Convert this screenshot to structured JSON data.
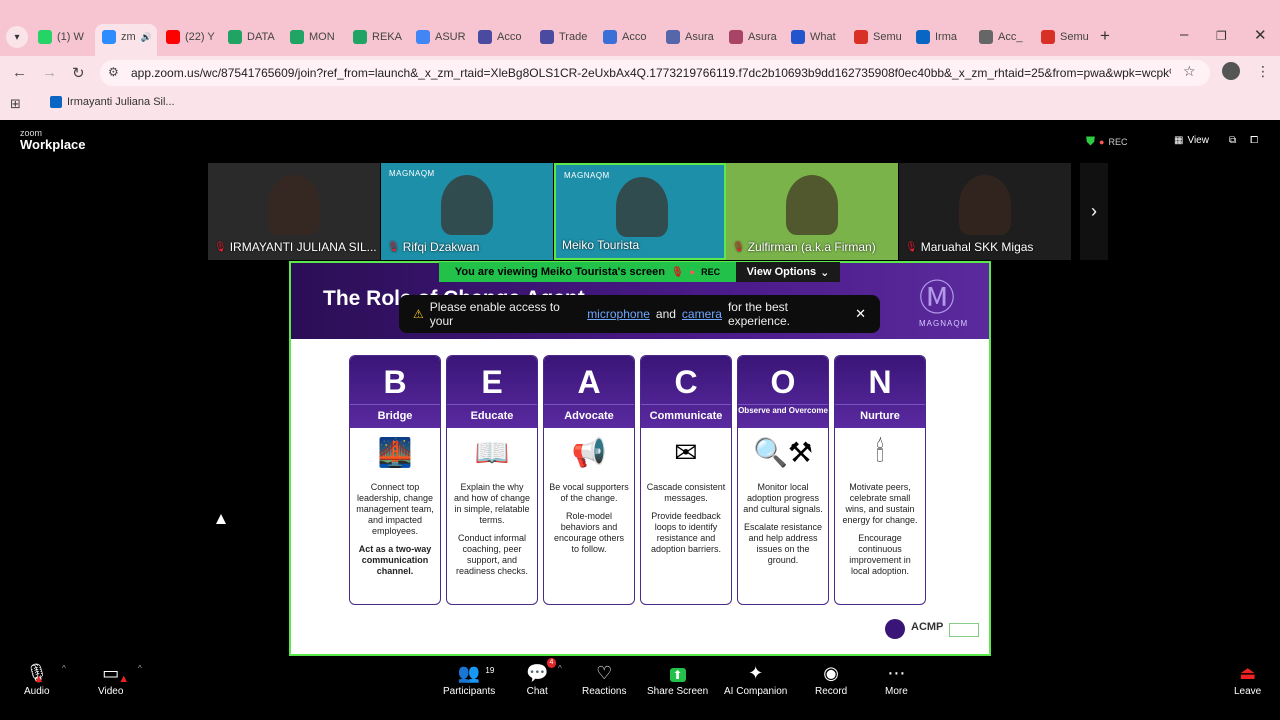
{
  "browser": {
    "tabs": [
      {
        "label": "(1) W",
        "color": "#25d366"
      },
      {
        "label": "zm",
        "color": "#2d8cff"
      },
      {
        "label": "(22) Y",
        "color": "#ff0000"
      },
      {
        "label": "DATA",
        "color": "#1fa463"
      },
      {
        "label": "MON",
        "color": "#1fa463"
      },
      {
        "label": "REKA",
        "color": "#1fa463"
      },
      {
        "label": "ASUR",
        "color": "#4285f4"
      },
      {
        "label": "Acco",
        "color": "#4a4aa0"
      },
      {
        "label": "Trade",
        "color": "#4a4aa0"
      },
      {
        "label": "Acco",
        "color": "#3a6fd8"
      },
      {
        "label": "Asura",
        "color": "#5566aa"
      },
      {
        "label": "Asura",
        "color": "#aa4466"
      },
      {
        "label": "What",
        "color": "#2255cc"
      },
      {
        "label": "Semu",
        "color": "#d93025"
      },
      {
        "label": "Irma",
        "color": "#0a66c2"
      },
      {
        "label": "Acc_",
        "color": "#666666"
      },
      {
        "label": "Semu",
        "color": "#d93025"
      }
    ],
    "url": "app.zoom.us/wc/87541765609/join?ref_from=launch&_x_zm_rtaid=XleBg8OLS1CR-2eUxbAx4Q.1773219766119.f7dc2b10693b9dd162735908f0ec40bb&_x_zm_rhtaid=25&from=pwa&wpk=wcpk%7B0...",
    "bookmark": "Irmayanti Juliana Sil..."
  },
  "zoom": {
    "brand_small": "zoom",
    "brand": "Workplace",
    "rec": "REC",
    "view": "View",
    "participants": [
      {
        "name": "IRMAYANTI JULIANA SIL...",
        "muted": true,
        "bg": "#2a2a2a"
      },
      {
        "name": "Rifqi Dzakwan",
        "muted": true,
        "bg": "#1d8fa8"
      },
      {
        "name": "Meiko Tourista",
        "muted": false,
        "bg": "#1d8fa8"
      },
      {
        "name": "Zulfirman (a.k.a Firman)",
        "muted": true,
        "bg": "#7ab34a"
      },
      {
        "name": "Maruahal SKK Migas",
        "muted": true,
        "bg": "#1e1e1e"
      }
    ],
    "magna_label": "MAGNAQM",
    "viewing_banner": "You are viewing  Meiko Tourista's screen",
    "banner_rec": "REC",
    "view_options": "View Options",
    "toast": {
      "text_before": "Please enable access to your",
      "microphone": "microphone",
      "and": "and",
      "camera": "camera",
      "text_after": "for the best experience."
    },
    "controls": {
      "audio": "Audio",
      "video": "Video",
      "participants": "Participants",
      "participants_count": "19",
      "chat": "Chat",
      "chat_badge": "4",
      "reactions": "Reactions",
      "share": "Share Screen",
      "ai": "AI Companion",
      "record": "Record",
      "more": "More",
      "leave": "Leave"
    }
  },
  "slide": {
    "title": "The Role of Change Agent",
    "logo_text": "MAGNAQM",
    "acmp": "ACMP",
    "cards": [
      {
        "letter": "B",
        "word": "Bridge",
        "icon": "🌉",
        "p1": "Connect top leadership, change management team, and impacted employees.",
        "p2": "Act as a two-way communication channel.",
        "p2bold": true
      },
      {
        "letter": "E",
        "word": "Educate",
        "icon": "📖",
        "p1": "Explain the why and how of change in simple, relatable terms.",
        "p2": "Conduct informal coaching, peer support, and readiness checks.",
        "p2bold": false
      },
      {
        "letter": "A",
        "word": "Advocate",
        "icon": "📢",
        "p1": "Be vocal supporters of the change.",
        "p2": "Role-model behaviors and encourage others to follow.",
        "p2bold": false
      },
      {
        "letter": "C",
        "word": "Communicate",
        "icon": "✉",
        "p1": "Cascade consistent messages.",
        "p2": "Provide feedback loops to identify resistance and adoption barriers.",
        "p2bold": false
      },
      {
        "letter": "O",
        "word": "Observe and Overcome",
        "icon": "🔍⚒",
        "p1": "Monitor local adoption progress and cultural signals.",
        "p2": "Escalate resistance and help address issues on the ground.",
        "p2bold": false
      },
      {
        "letter": "N",
        "word": "Nurture",
        "icon": "🕯",
        "p1": "Motivate peers, celebrate small wins, and sustain energy for change.",
        "p2": "Encourage continuous improvement in local adoption.",
        "p2bold": false
      }
    ]
  }
}
